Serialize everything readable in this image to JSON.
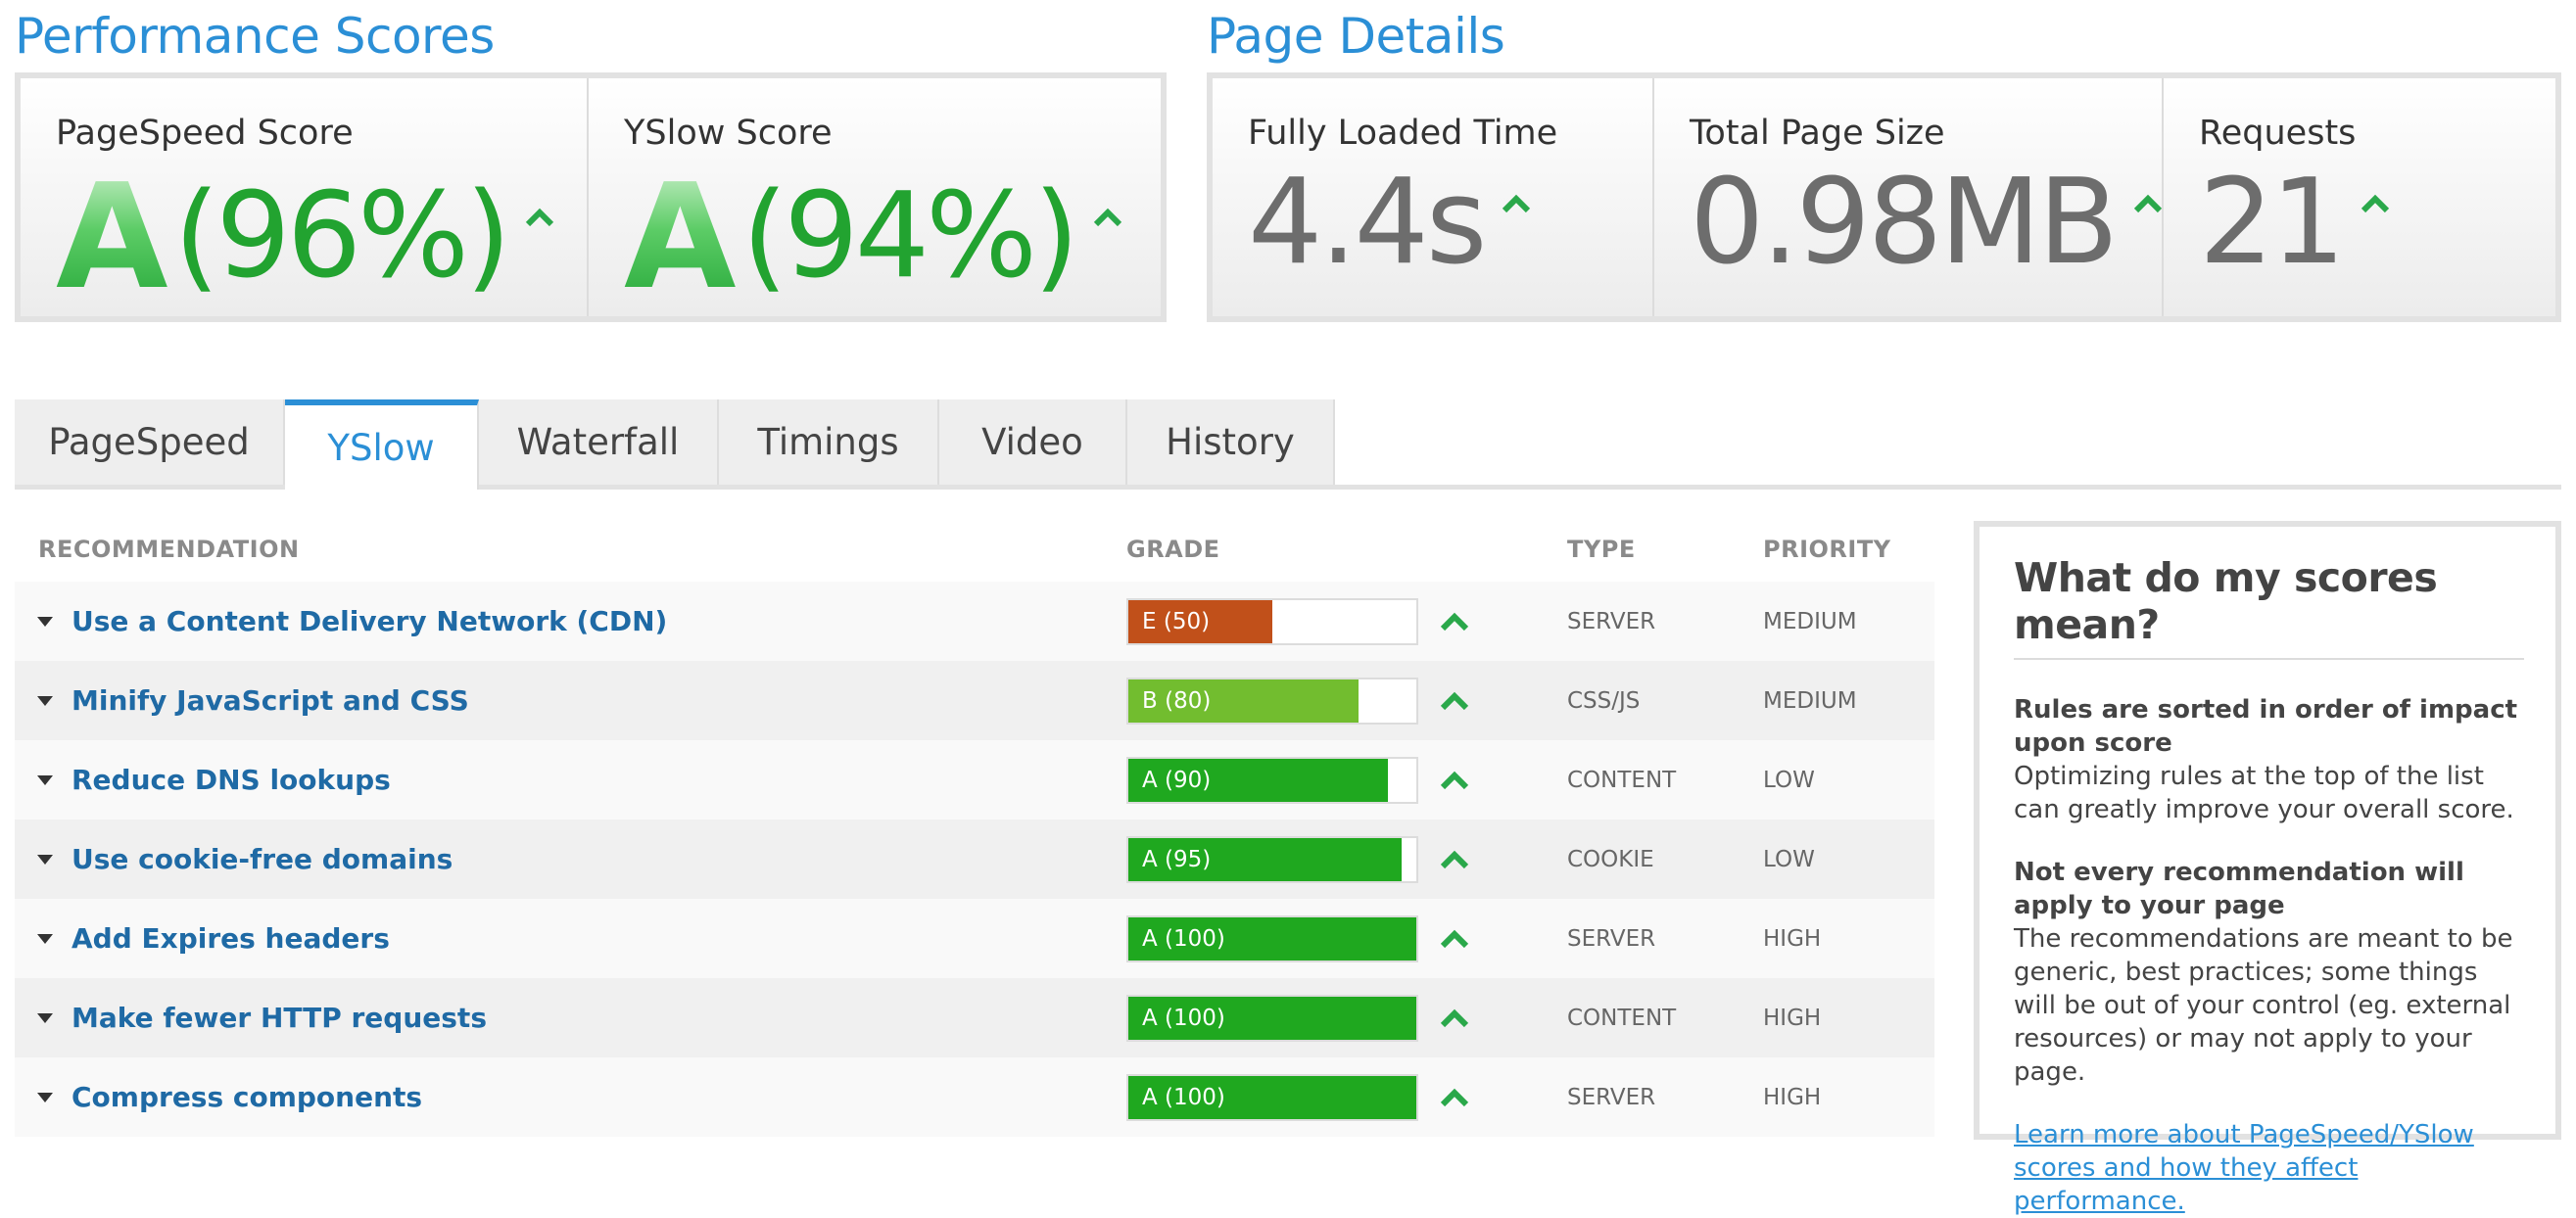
{
  "performance": {
    "title": "Performance Scores",
    "pagespeed": {
      "label": "PageSpeed Score",
      "grade": "A",
      "percent": "(96%)"
    },
    "yslow": {
      "label": "YSlow Score",
      "grade": "A",
      "percent": "(94%)"
    }
  },
  "details": {
    "title": "Page Details",
    "load_time": {
      "label": "Fully Loaded Time",
      "value": "4.4s"
    },
    "page_size": {
      "label": "Total Page Size",
      "value": "0.98MB"
    },
    "requests": {
      "label": "Requests",
      "value": "21"
    }
  },
  "tabs": [
    {
      "label": "PageSpeed",
      "active": false
    },
    {
      "label": "YSlow",
      "active": true
    },
    {
      "label": "Waterfall",
      "active": false
    },
    {
      "label": "Timings",
      "active": false
    },
    {
      "label": "Video",
      "active": false
    },
    {
      "label": "History",
      "active": false
    }
  ],
  "table": {
    "headers": {
      "recommendation": "RECOMMENDATION",
      "grade": "GRADE",
      "type": "TYPE",
      "priority": "PRIORITY"
    },
    "rows": [
      {
        "name": "Use a Content Delivery Network (CDN)",
        "grade": "E (50)",
        "score": 50,
        "color": "#c1501a",
        "type": "SERVER",
        "priority": "MEDIUM"
      },
      {
        "name": "Minify JavaScript and CSS",
        "grade": "B (80)",
        "score": 80,
        "color": "#72bd2f",
        "type": "CSS/JS",
        "priority": "MEDIUM"
      },
      {
        "name": "Reduce DNS lookups",
        "grade": "A (90)",
        "score": 90,
        "color": "#1fa81f",
        "type": "CONTENT",
        "priority": "LOW"
      },
      {
        "name": "Use cookie-free domains",
        "grade": "A (95)",
        "score": 95,
        "color": "#1fa81f",
        "type": "COOKIE",
        "priority": "LOW"
      },
      {
        "name": "Add Expires headers",
        "grade": "A (100)",
        "score": 100,
        "color": "#1fa81f",
        "type": "SERVER",
        "priority": "HIGH"
      },
      {
        "name": "Make fewer HTTP requests",
        "grade": "A (100)",
        "score": 100,
        "color": "#1fa81f",
        "type": "CONTENT",
        "priority": "HIGH"
      },
      {
        "name": "Compress components",
        "grade": "A (100)",
        "score": 100,
        "color": "#1fa81f",
        "type": "SERVER",
        "priority": "HIGH"
      }
    ]
  },
  "info": {
    "title": "What do my scores mean?",
    "block1_heading": "Rules are sorted in order of impact upon score",
    "block1_text": "Optimizing rules at the top of the list can greatly improve your overall score.",
    "block2_heading": "Not every recommendation will apply to your page",
    "block2_text": "The recommendations are meant to be generic, best practices; some things will be out of your control (eg. external resources) or may not apply to your page.",
    "link": "Learn more about PageSpeed/YSlow scores and how they affect performance."
  },
  "colors": {
    "accent": "#2b8fd6",
    "grade_green": "#22a330",
    "arrow_green": "#2aa84a"
  },
  "icons": {
    "trend": "up-arrow-icon",
    "expand": "caret-down-icon"
  }
}
